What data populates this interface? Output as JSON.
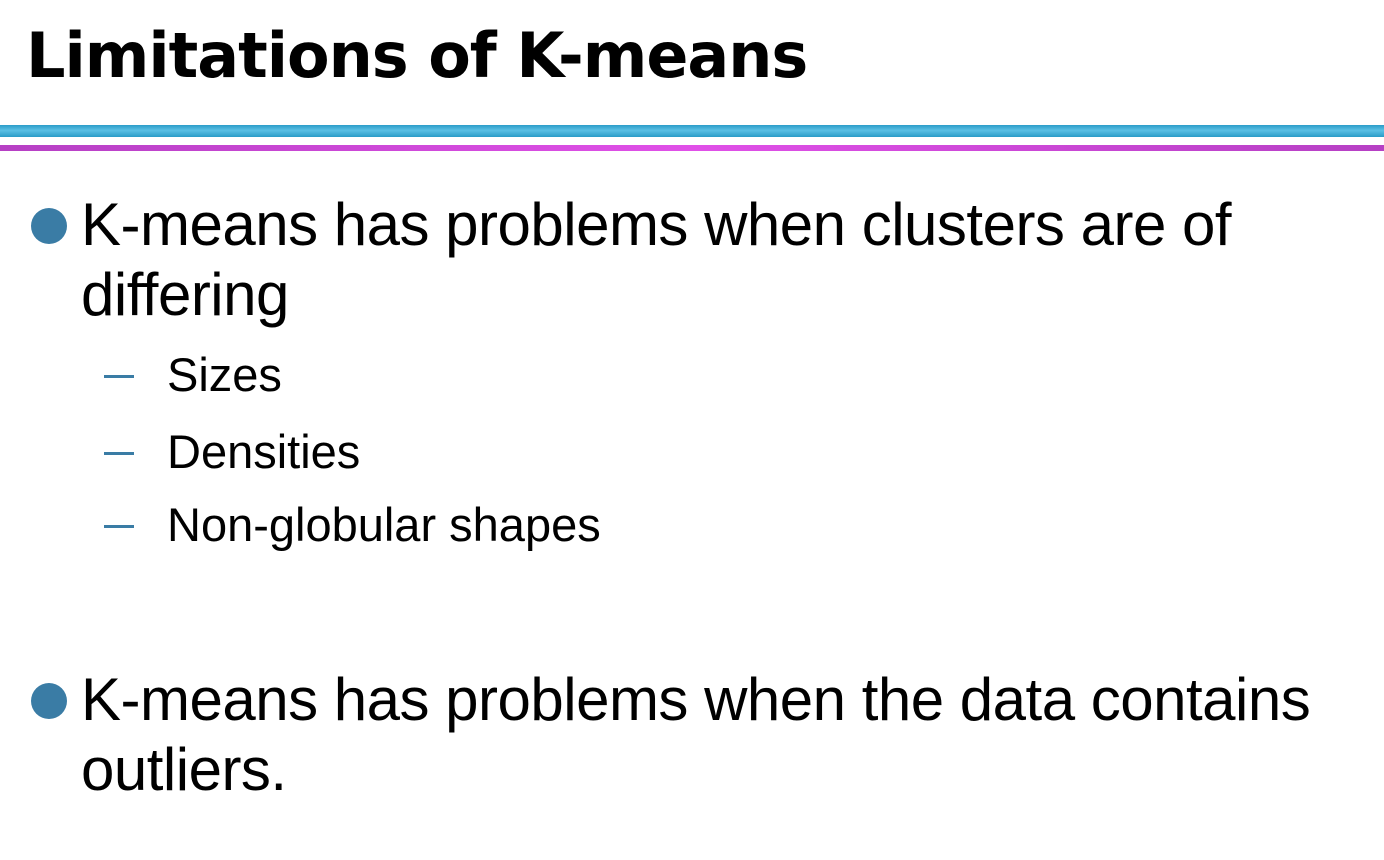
{
  "slide": {
    "title": "Limitations of K-means",
    "bullets": [
      {
        "text": "K-means has problems when clusters are of differing",
        "sub_items": [
          "Sizes",
          "Densities",
          "Non-globular shapes"
        ]
      },
      {
        "text": "K-means has problems when the data contains outliers.",
        "sub_items": []
      }
    ]
  },
  "colors": {
    "bullet": "#3a7ca5",
    "rule_blue": "#2a9cc8",
    "rule_magenta": "#d04ad8"
  },
  "icons": {
    "bullet": "filled-circle-icon",
    "sub_bullet": "dash-icon"
  }
}
